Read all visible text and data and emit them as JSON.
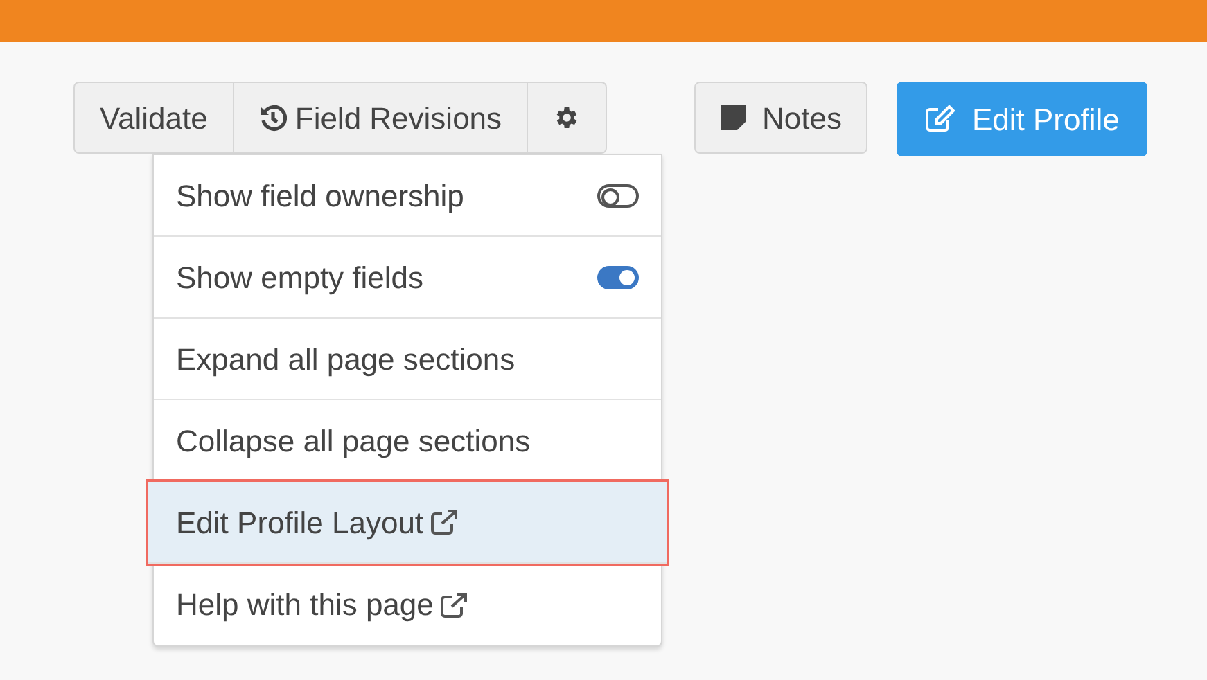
{
  "toolbar": {
    "group": [
      {
        "kind": "text",
        "label": "Validate"
      },
      {
        "kind": "history",
        "label": "Field Revisions"
      },
      {
        "kind": "gear"
      }
    ],
    "notes": {
      "label": "Notes"
    },
    "edit": {
      "label": "Edit Profile"
    }
  },
  "menu": {
    "items": [
      {
        "kind": "toggle",
        "label": "Show field ownership",
        "on": false,
        "selected": false
      },
      {
        "kind": "toggle",
        "label": "Show empty fields",
        "on": true,
        "selected": false
      },
      {
        "kind": "plain",
        "label": "Expand all page sections",
        "selected": false
      },
      {
        "kind": "plain",
        "label": "Collapse all page sections",
        "selected": false
      },
      {
        "kind": "external",
        "label": "Edit Profile Layout",
        "selected": true
      },
      {
        "kind": "external",
        "label": "Help with this page",
        "selected": false
      }
    ]
  }
}
